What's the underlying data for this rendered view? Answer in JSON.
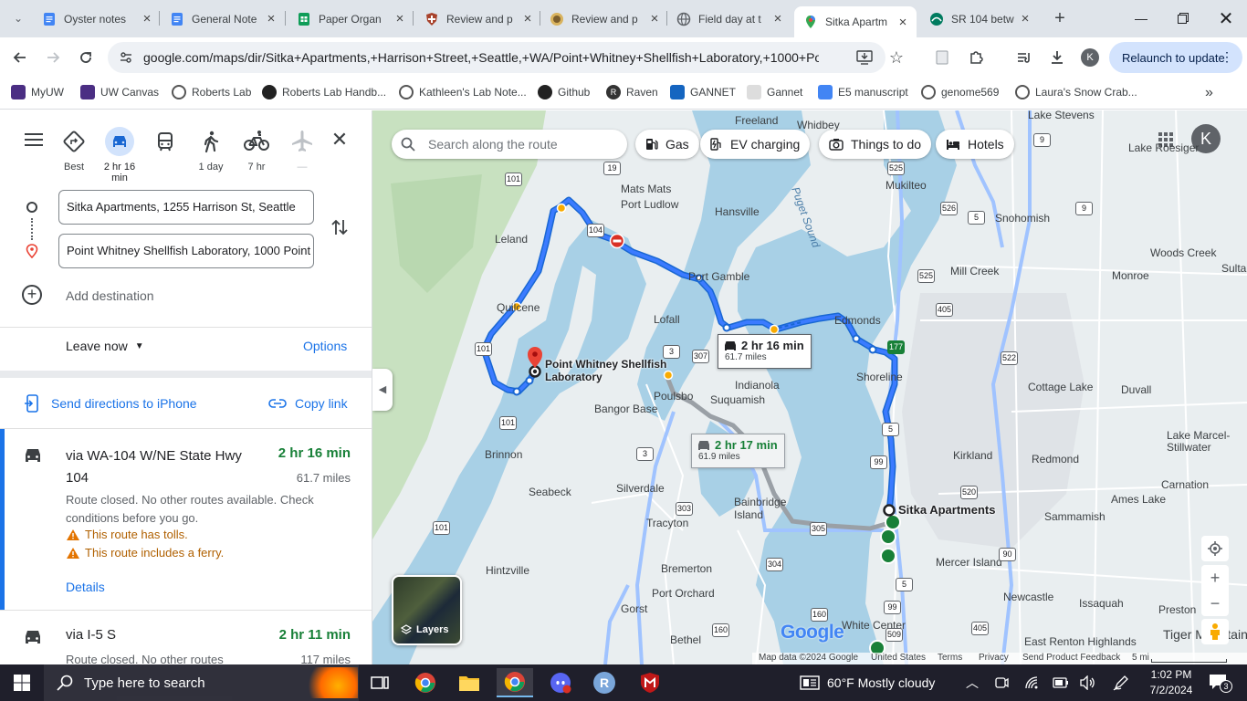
{
  "tabs": [
    {
      "title": "Oyster notes",
      "icon": "docs-icon",
      "color": "#4285f4"
    },
    {
      "title": "General Note",
      "icon": "docs-icon",
      "color": "#4285f4"
    },
    {
      "title": "Paper Organ",
      "icon": "sheets-icon",
      "color": "#0f9d58"
    },
    {
      "title": "Review and p",
      "icon": "shield-favicon-icon",
      "color": "#a8422c"
    },
    {
      "title": "Review and p",
      "icon": "review-favicon-icon",
      "color": "#7b5e2d"
    },
    {
      "title": "Field day at t",
      "icon": "globe-icon",
      "color": "#5f6368"
    },
    {
      "title": "Sitka Apartm",
      "icon": "maps-pin-icon",
      "color": "#ea4335"
    },
    {
      "title": "SR 104 betw",
      "icon": "wsdot-icon",
      "color": "#007b5f"
    }
  ],
  "address_bar": {
    "url": "google.com/maps/dir/Sitka+Apartments,+Harrison+Street,+Seattle,+WA/Point+Whitney+Shellfish+Laboratory,+1000+Poin..."
  },
  "relaunch_label": "Relaunch to update",
  "profile_initial": "K",
  "bookmarks": [
    {
      "label": "MyUW",
      "color": "#4b2e83"
    },
    {
      "label": "UW Canvas",
      "color": "#4b2e83"
    },
    {
      "label": "Roberts Lab",
      "color": "#444"
    },
    {
      "label": "Roberts Lab Handb...",
      "color": "#222"
    },
    {
      "label": "Kathleen's Lab Note...",
      "color": "#444"
    },
    {
      "label": "Github",
      "color": "#222"
    },
    {
      "label": "Raven",
      "color": "#333"
    },
    {
      "label": "GANNET",
      "color": "#1565c0"
    },
    {
      "label": "Gannet",
      "color": "#666"
    },
    {
      "label": "E5 manuscript",
      "color": "#4285f4"
    },
    {
      "label": "genome569",
      "color": "#444"
    },
    {
      "label": "Laura's Snow Crab...",
      "color": "#444"
    }
  ],
  "modes": [
    {
      "label": "Best",
      "icon": "diamond-route-icon"
    },
    {
      "label": "2 hr 16 min",
      "icon": "car-icon"
    },
    {
      "label": "",
      "icon": "transit-icon"
    },
    {
      "label": "1 day",
      "icon": "walk-icon"
    },
    {
      "label": "7 hr",
      "icon": "bike-icon"
    },
    {
      "label": "—",
      "icon": "plane-icon"
    }
  ],
  "origin": "Sitka Apartments, 1255 Harrison St, Seattle",
  "destination": "Point Whitney Shellfish Laboratory, 1000 Point",
  "add_destination": "Add destination",
  "leave_now": "Leave now",
  "options": "Options",
  "send_directions": "Send directions to iPhone",
  "copy_link": "Copy link",
  "routes": [
    {
      "name": "via WA-104 W/NE State Hwy 104",
      "time": "2 hr 16 min",
      "distance": "61.7 miles",
      "status": "Route closed. No other routes available. Check conditions before you go.",
      "warnings": [
        "This route has tolls.",
        "This route includes a ferry."
      ],
      "details": "Details"
    },
    {
      "name": "via I-5 S",
      "time": "2 hr 11 min",
      "distance": "117 miles",
      "status": "Route closed. No other routes"
    }
  ],
  "map": {
    "search_placeholder": "Search along the route",
    "chips": [
      "Gas",
      "EV charging",
      "Things to do",
      "Hotels"
    ],
    "callout_main": {
      "time": "2 hr 16 min",
      "distance": "61.7 miles"
    },
    "callout_alt": {
      "time": "2 hr 17 min",
      "distance": "61.9 miles"
    },
    "origin_label": "Sitka Apartments",
    "destination_label": "Point Whitney Shellfish Laboratory",
    "places": [
      "Freeland",
      "Whidbey",
      "Lake Stevens",
      "Lake Roesiger",
      "Mukilteo",
      "Mats Mats",
      "Port Ludlow",
      "Hansville",
      "Puget Sound",
      "Snohomish",
      "Leland",
      "Woods Creek",
      "Sultan",
      "Port Gamble",
      "Mill Creek",
      "Monroe",
      "Quilcene",
      "Lofall",
      "Edmonds",
      "Shoreline",
      "Indianola",
      "Suquamish",
      "Poulsbo",
      "Bangor Base",
      "Cottage Lake",
      "Duvall",
      "Kirkland",
      "Redmond",
      "Lake Marcel-Stillwater",
      "Brinnon",
      "Seabeck",
      "Silverdale",
      "Carnation",
      "Ames Lake",
      "Bainbridge Island",
      "Tracyton",
      "Sammamish",
      "Hintzville",
      "Bremerton",
      "Mercer Island",
      "Port Orchard",
      "Newcastle",
      "Issaquah",
      "Preston",
      "Gorst",
      "White Center",
      "Bethel",
      "Tiger Mountain",
      "East Renton Highlands"
    ],
    "layers": "Layers",
    "google": "Google",
    "footer": [
      "Map data ©2024 Google",
      "United States",
      "Terms",
      "Privacy",
      "Send Product Feedback",
      "5 mi"
    ]
  },
  "taskbar": {
    "search_placeholder": "Type here to search",
    "weather": "60°F  Mostly cloudy",
    "time": "1:02 PM",
    "date": "7/2/2024",
    "notifications": "3"
  }
}
